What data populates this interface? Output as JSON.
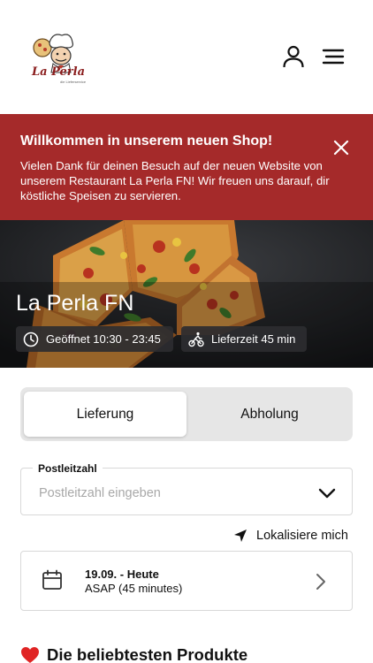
{
  "header": {
    "logo_text": "La Perla",
    "logo_subtext": "die Lieferservice",
    "user_icon": "user-icon",
    "menu_icon": "hamburger-menu-icon"
  },
  "banner": {
    "title": "Willkommen in unserem neuen Shop!",
    "text": "Vielen Dank für deinen Besuch auf der neuen Website von unserem Restaurant La Perla FN! Wir freuen uns darauf, dir köstliche Speisen zu servieren.",
    "close_icon": "close-icon",
    "color": "#a52a2a"
  },
  "hero": {
    "restaurant_name": "La Perla FN",
    "opening_hours": "Geöffnet 10:30 - 23:45",
    "delivery_time": "Lieferzeit 45 min",
    "clock_icon": "clock-icon",
    "bike_icon": "bike-courier-icon"
  },
  "order_mode": {
    "delivery_label": "Lieferung",
    "pickup_label": "Abholung",
    "selected": "Lieferung"
  },
  "postcode": {
    "label": "Postleitzahl",
    "placeholder": "Postleitzahl eingeben",
    "value": ""
  },
  "locate": {
    "label": "Lokalisiere mich",
    "icon": "location-arrow-icon"
  },
  "schedule": {
    "date": "19.09. - Heute",
    "time": "ASAP (45 minutes)",
    "icon": "calendar-icon"
  },
  "popular": {
    "title": "Die beliebtesten Produkte",
    "icon": "heart-icon",
    "icon_color": "#e02424"
  }
}
